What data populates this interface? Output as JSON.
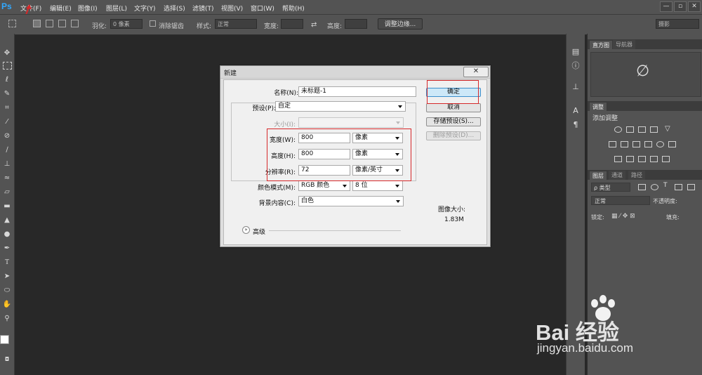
{
  "app": {
    "logo": "Ps"
  },
  "menu": [
    "文件(F)",
    "编辑(E)",
    "图像(I)",
    "图层(L)",
    "文字(Y)",
    "选择(S)",
    "滤镜(T)",
    "视图(V)",
    "窗口(W)",
    "帮助(H)"
  ],
  "window_controls": [
    "—",
    "▫",
    "✕"
  ],
  "options": {
    "feather_label": "羽化:",
    "feather_value": "0 像素",
    "antialias_label": "消除锯齿",
    "style_label": "样式:",
    "style_value": "正常",
    "width_label": "宽度:",
    "height_label": "高度:",
    "refine_button": "调整边缘...",
    "workspace": "摄影"
  },
  "panels": {
    "tabs_top": [
      "直方图",
      "导航器"
    ],
    "adjust_tab": "调整",
    "adjust_title": "添加调整",
    "layers_tabs": [
      "图层",
      "通道",
      "路径"
    ],
    "kind_value": "ρ 类型",
    "blend_mode": "正常",
    "opacity_label": "不透明度:",
    "lock_label": "锁定:",
    "fill_label": "填充:"
  },
  "dialog": {
    "title": "新建",
    "name_label": "名称(N):",
    "name_value": "未标题-1",
    "preset_label": "预设(P):",
    "preset_value": "自定",
    "size_label": "大小(I):",
    "width_label": "宽度(W):",
    "width_value": "800",
    "width_unit": "像素",
    "height_label": "高度(H):",
    "height_value": "800",
    "height_unit": "像素",
    "resolution_label": "分辨率(R):",
    "resolution_value": "72",
    "resolution_unit": "像素/英寸",
    "color_mode_label": "颜色模式(M):",
    "color_mode_value": "RGB 颜色",
    "bit_depth_value": "8 位",
    "background_label": "背景内容(C):",
    "background_value": "白色",
    "advanced_label": "高级",
    "ok_button": "确定",
    "cancel_button": "取消",
    "save_preset_button": "存储预设(S)...",
    "delete_preset_button": "删除预设(D)...",
    "image_size_label": "图像大小:",
    "image_size_value": "1.83M"
  },
  "watermark": {
    "logo": "Bai 经验",
    "url": "jingyan.baidu.com"
  },
  "colors": {
    "annotation_red": "#d6282a",
    "ps_blue": "#31a8ff"
  }
}
